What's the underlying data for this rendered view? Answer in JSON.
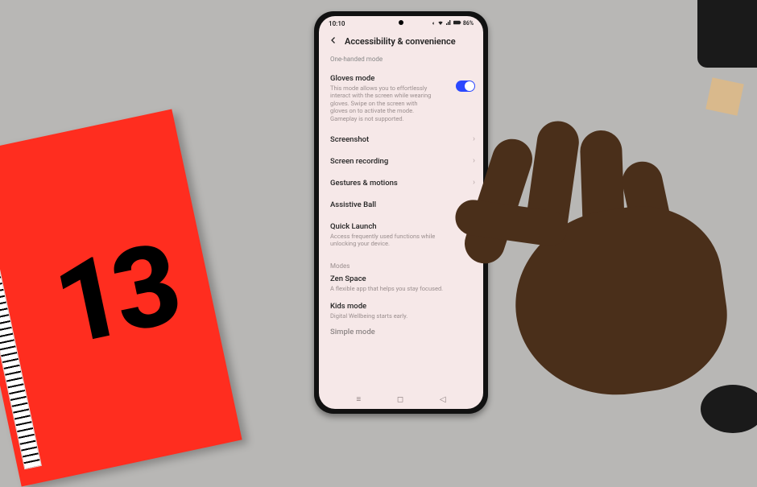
{
  "statusbar": {
    "time": "10:10",
    "battery": "86%"
  },
  "header": {
    "title": "Accessibility & convenience"
  },
  "cutoff_item": "One-handed mode",
  "items": {
    "gloves": {
      "title": "Gloves mode",
      "desc": "This mode allows you to effortlessly interact with the screen while wearing gloves. Swipe on the screen with gloves on to activate the mode. Gameplay is not supported."
    },
    "screenshot": {
      "title": "Screenshot"
    },
    "recording": {
      "title": "Screen recording"
    },
    "gestures": {
      "title": "Gestures & motions"
    },
    "assistive": {
      "title": "Assistive Ball"
    },
    "quick": {
      "title": "Quick Launch",
      "desc": "Access frequently used functions while unlocking your device."
    }
  },
  "section_modes": "Modes",
  "modes": {
    "zen": {
      "title": "Zen Space",
      "desc": "A flexible app that helps you stay focused."
    },
    "kids": {
      "title": "Kids mode",
      "desc": "Digital Wellbeing starts early."
    },
    "simple": {
      "title": "Simple mode"
    }
  },
  "box_number": "13"
}
